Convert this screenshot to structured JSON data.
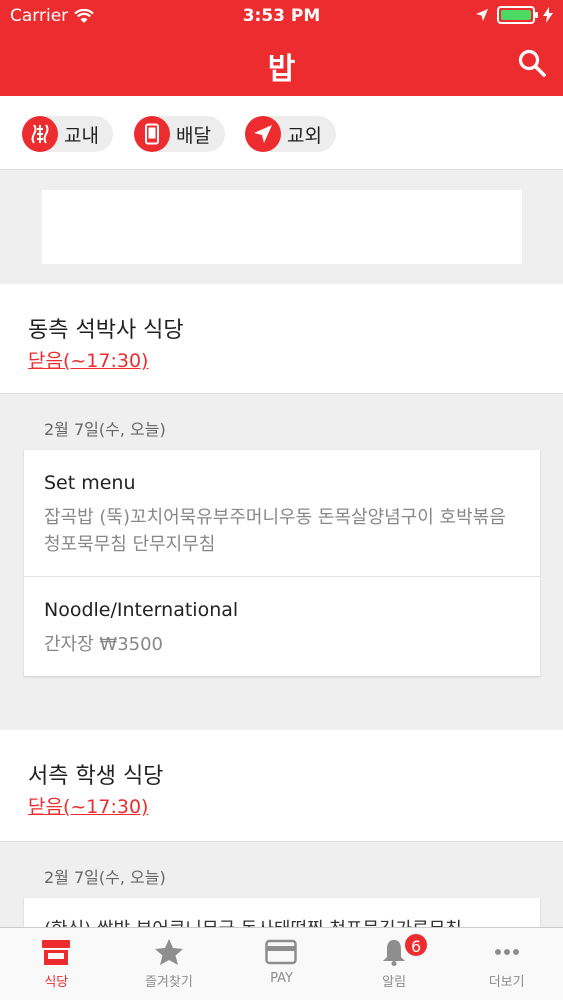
{
  "status_bar": {
    "carrier": "Carrier",
    "time": "3:53 PM"
  },
  "header": {
    "title": "밥"
  },
  "filters": [
    {
      "label": "교내",
      "icon": "campus-icon"
    },
    {
      "label": "배달",
      "icon": "phone-icon"
    },
    {
      "label": "교외",
      "icon": "location-arrow-icon"
    }
  ],
  "restaurants": [
    {
      "name": "동측 석박사 식당",
      "status": "닫음(~17:30)",
      "date": "2월 7일(수, 오늘)",
      "menus": [
        {
          "title": "Set menu",
          "desc": "잡곡밥 (뚝)꼬치어묵유부주머니우동 돈목살양념구이 호박볶음 청포묵무침 단무지무침"
        },
        {
          "title": "Noodle/International",
          "desc": "간자장 ₩3500"
        }
      ]
    },
    {
      "name": "서측 학생 식당",
      "status": "닫음(~17:30)",
      "date": "2월 7일(수, 오늘)",
      "menus": [
        {
          "title": "",
          "desc": "(한식) 쌀밥 부어큐니무국 돈사태떡찜 청포묵김가루무침"
        }
      ]
    }
  ],
  "tabbar": [
    {
      "label": "식당",
      "icon": "store-icon",
      "active": true
    },
    {
      "label": "즐겨찾기",
      "icon": "star-icon"
    },
    {
      "label": "PAY",
      "icon": "card-icon"
    },
    {
      "label": "알림",
      "icon": "bell-icon",
      "badge": "6"
    },
    {
      "label": "더보기",
      "icon": "more-icon"
    }
  ],
  "colors": {
    "brand": "#ec2c2e",
    "battery": "#4cd964"
  }
}
